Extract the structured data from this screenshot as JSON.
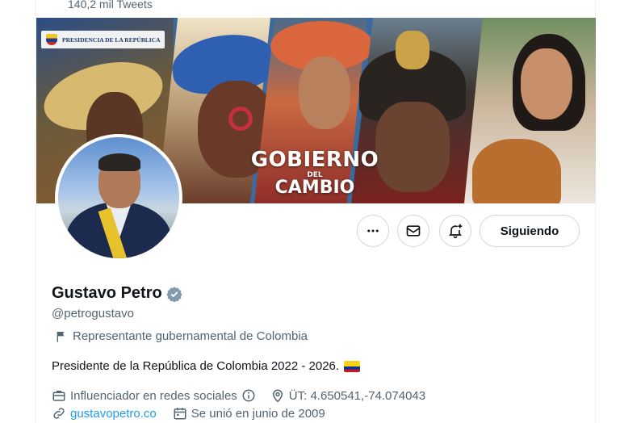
{
  "header": {
    "tweet_count": "140,2 mil Tweets"
  },
  "banner": {
    "logo_text": "PRESIDENCIA DE LA REPÚBLICA",
    "headline_line1": "GOBIERNO",
    "headline_line2": "DEL",
    "headline_line3": "CAMBIO"
  },
  "actions": {
    "more_icon": "more-icon",
    "message_icon": "envelope-icon",
    "notify_icon": "bell-plus-icon",
    "follow_label": "Siguiendo"
  },
  "profile": {
    "display_name": "Gustavo Petro",
    "handle": "@petrogustavo",
    "affiliation_label": "Representante gubernamental de Colombia",
    "bio": "Presidente de la República de Colombia 2022 - 2026.",
    "category": "Influenciador en redes sociales",
    "location": "ÜT: 4.650541,-74.074043",
    "website": "gustavopetro.co",
    "joined": "Se unió en junio de 2009"
  },
  "colors": {
    "accent": "#1d9bf0",
    "secondary_text": "#536471",
    "border": "#cfd9de"
  }
}
